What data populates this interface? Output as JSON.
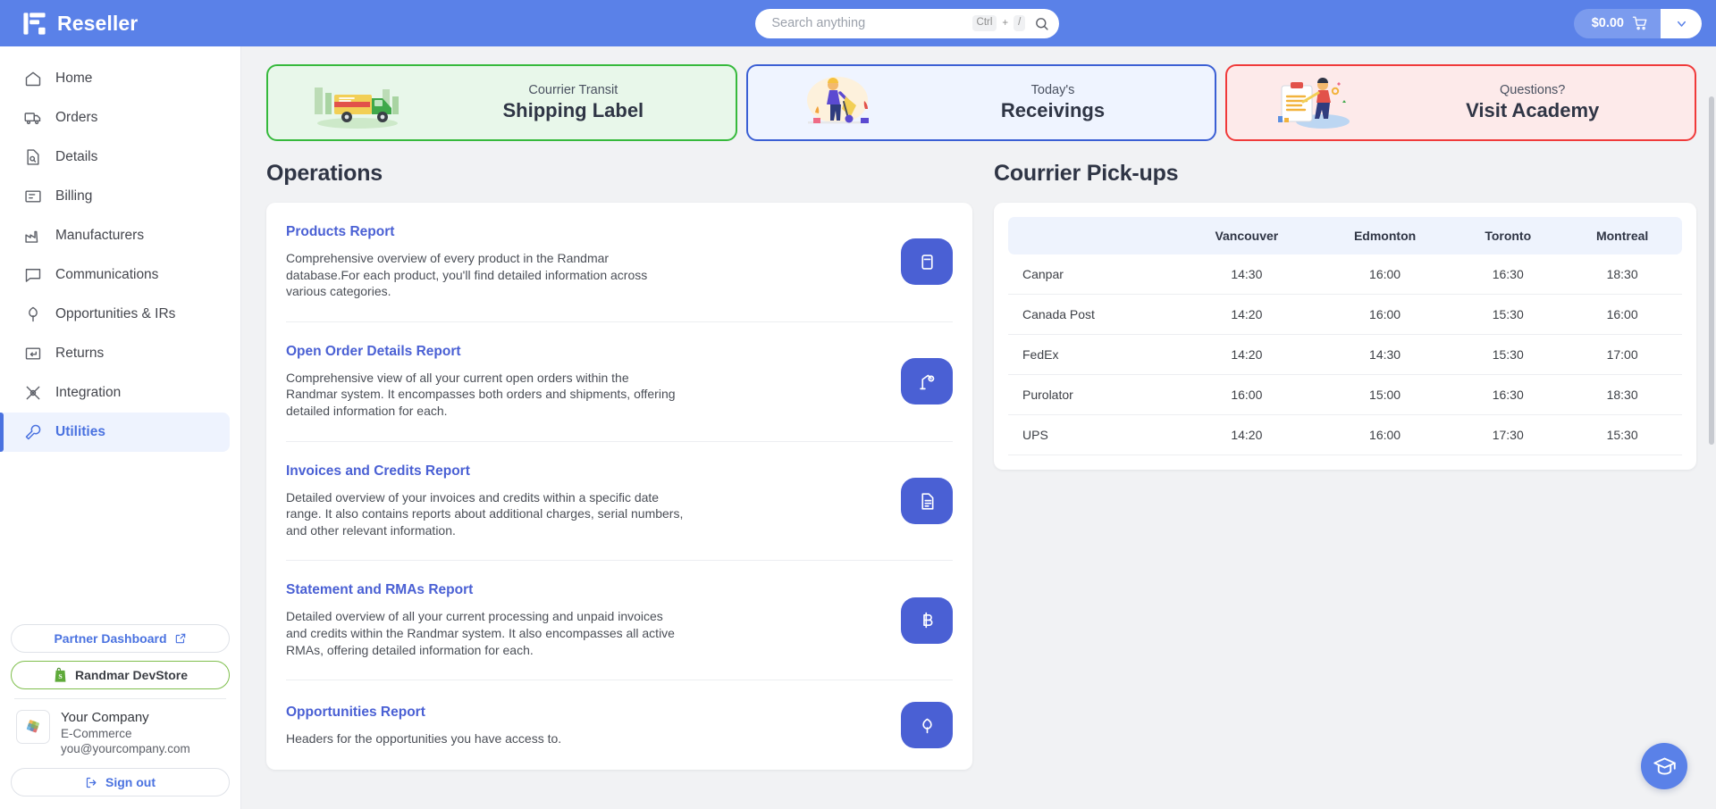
{
  "app": {
    "brand_name": "Reseller"
  },
  "search": {
    "placeholder": "Search anything",
    "shortcut_key": "Ctrl",
    "shortcut_plus": "+",
    "shortcut_slash": "/"
  },
  "cart": {
    "total": "$0.00"
  },
  "sidebar": {
    "items": [
      {
        "label": "Home",
        "icon": "home-icon",
        "active": false
      },
      {
        "label": "Orders",
        "icon": "truck-icon",
        "active": false
      },
      {
        "label": "Details",
        "icon": "document-search-icon",
        "active": false
      },
      {
        "label": "Billing",
        "icon": "billing-icon",
        "active": false
      },
      {
        "label": "Manufacturers",
        "icon": "factory-icon",
        "active": false
      },
      {
        "label": "Communications",
        "icon": "chat-bubble-icon",
        "active": false
      },
      {
        "label": "Opportunities & IRs",
        "icon": "flower-icon",
        "active": false
      },
      {
        "label": "Returns",
        "icon": "return-arrow-icon",
        "active": false
      },
      {
        "label": "Integration",
        "icon": "integration-icon",
        "active": false
      },
      {
        "label": "Utilities",
        "icon": "wrench-icon",
        "active": true
      }
    ],
    "partner_dashboard": "Partner Dashboard",
    "devstore": "Randmar DevStore",
    "company": {
      "name": "Your Company",
      "type": "E-Commerce",
      "email": "you@yourcompany.com"
    },
    "sign_out": "Sign out"
  },
  "banners": [
    {
      "kicker": "Courrier Transit",
      "title": "Shipping Label",
      "theme": "green",
      "art": "delivery-truck-illustration"
    },
    {
      "kicker": "Today's",
      "title": "Receivings",
      "theme": "blue",
      "art": "worker-dolly-illustration"
    },
    {
      "kicker": "Questions?",
      "title": "Visit Academy",
      "theme": "red",
      "art": "clipboard-person-illustration"
    }
  ],
  "operations": {
    "title": "Operations",
    "reports": [
      {
        "title": "Products Report",
        "description": "Comprehensive overview of every product in the Randmar database.For each product, you'll find detailed information across various categories.",
        "icon": "database-icon"
      },
      {
        "title": "Open Order Details Report",
        "description": "Comprehensive view of all your current open orders within the Randmar system. It encompasses both orders and shipments, offering detailed information for each.",
        "icon": "robot-arm-icon"
      },
      {
        "title": "Invoices and Credits Report",
        "description": "Detailed overview of your invoices and credits within a specific date range. It also contains reports about additional charges, serial numbers, and other relevant information.",
        "icon": "file-text-icon"
      },
      {
        "title": "Statement and RMAs Report",
        "description": "Detailed overview of all your current processing and unpaid invoices and credits within the Randmar system. It also encompasses all active RMAs, offering detailed information for each.",
        "icon": "bitcoin-icon"
      },
      {
        "title": "Opportunities Report",
        "description": "Headers for the opportunities you have access to.",
        "icon": "flower-icon"
      }
    ]
  },
  "pickups": {
    "title": "Courrier Pick-ups",
    "columns": [
      "",
      "Vancouver",
      "Edmonton",
      "Toronto",
      "Montreal"
    ],
    "rows": [
      {
        "courier": "Canpar",
        "times": [
          "14:30",
          "16:00",
          "16:30",
          "18:30"
        ]
      },
      {
        "courier": "Canada Post",
        "times": [
          "14:20",
          "16:00",
          "15:30",
          "16:00"
        ]
      },
      {
        "courier": "FedEx",
        "times": [
          "14:20",
          "14:30",
          "15:30",
          "17:00"
        ]
      },
      {
        "courier": "Purolator",
        "times": [
          "16:00",
          "15:00",
          "16:30",
          "18:30"
        ]
      },
      {
        "courier": "UPS",
        "times": [
          "14:20",
          "16:00",
          "17:30",
          "15:30"
        ]
      }
    ]
  },
  "fab": {
    "icon": "graduation-cap-icon"
  },
  "colors": {
    "brand_blue": "#5a81e8",
    "accent_indigo": "#4a60d4",
    "green": "#36b93c",
    "red": "#f03a3a",
    "page_bg": "#f1f2f4"
  }
}
